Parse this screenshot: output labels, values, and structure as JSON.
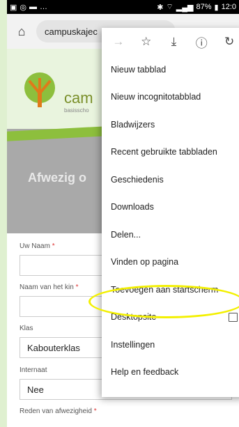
{
  "status_bar": {
    "left_text": "…",
    "battery": "87%",
    "time": "12:0"
  },
  "browser": {
    "url": "campuskajec"
  },
  "site": {
    "logo_text": "cam",
    "logo_sub": "basisscho",
    "hero_title": "Afwezig o"
  },
  "form": {
    "name_label": "Uw Naam",
    "child_label": "Naam van het kin",
    "class_label": "Klas",
    "class_value": "Kabouterklas",
    "boarding_label": "Internaat",
    "boarding_value": "Nee",
    "reason_label": "Reden van afwezigheid"
  },
  "menu": {
    "items": [
      {
        "label": "Nieuw tabblad"
      },
      {
        "label": "Nieuw incognitotabblad"
      },
      {
        "label": "Bladwijzers"
      },
      {
        "label": "Recent gebruikte tabbladen"
      },
      {
        "label": "Geschiedenis"
      },
      {
        "label": "Downloads"
      },
      {
        "label": "Delen..."
      },
      {
        "label": "Vinden op pagina"
      },
      {
        "label": "Toevoegen aan startscherm"
      },
      {
        "label": "Desktopsite"
      },
      {
        "label": "Instellingen"
      },
      {
        "label": "Help en feedback"
      }
    ]
  },
  "colors": {
    "highlight": "#f3f000",
    "logo_green": "#7a8f2a",
    "accent_green": "#8dbf3d"
  }
}
